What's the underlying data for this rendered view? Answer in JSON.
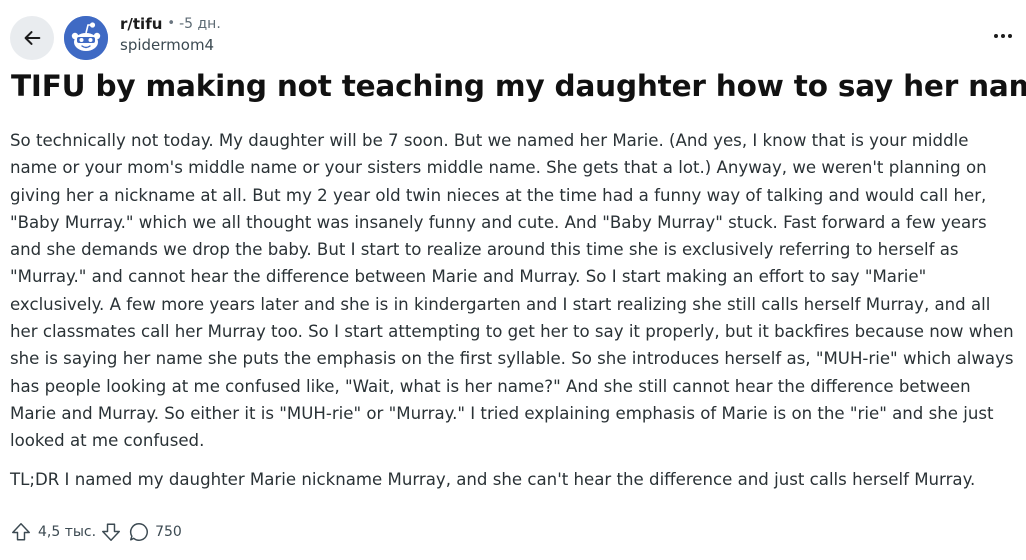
{
  "header": {
    "back_icon": "arrow-left-icon",
    "avatar_icon": "reddit-snoo-icon",
    "subreddit": "r/tifu",
    "separator": "•",
    "age": "-5 дн.",
    "author": "spidermom4",
    "more_icon": "more-horizontal-icon"
  },
  "post": {
    "title": "TIFU by making not teaching my daughter how to say her name.",
    "body": "So technically not today. My daughter will be 7 soon. But we named her Marie. (And yes, I know that is your middle name or your mom's middle name or your sisters middle name. She gets that a lot.) Anyway, we weren't planning on giving her a nickname at all. But my 2 year old twin nieces at the time had a funny way of talking and would call her, \"Baby Murray.\" which we all thought was insanely funny and cute. And \"Baby Murray\" stuck. Fast forward a few years and she demands we drop the baby. But I start to realize around this time she is exclusively referring to herself as \"Murray.\" and cannot hear the difference between Marie and Murray. So I start making an effort to say \"Marie\" exclusively. A few more years later and she is in kindergarten and I start realizing she still calls herself Murray, and all her classmates call her Murray too. So I start attempting to get her to say it properly, but it backfires because now when she is saying her name she puts the emphasis on the first syllable. So she introduces herself as, \"MUH-rie\" which always has people looking at me confused like, \"Wait, what is her name?\" And she still cannot hear the difference between Marie and Murray. So either it is \"MUH-rie\" or \"Murray.\" I tried explaining emphasis of Marie is on the \"rie\" and she just looked at me confused.",
    "tldr": "TL;DR I named my daughter Marie nickname Murray, and she can't hear the difference and just calls herself Murray."
  },
  "actions": {
    "upvote_icon": "upvote-arrow-icon",
    "score": "4,5 тыс.",
    "downvote_icon": "downvote-arrow-icon",
    "comment_icon": "comment-bubble-icon",
    "comments": "750"
  },
  "colors": {
    "avatar_bg": "#3f6ac4",
    "back_button_bg": "#e9ecef",
    "text": "#2a3236",
    "title": "#111111"
  }
}
